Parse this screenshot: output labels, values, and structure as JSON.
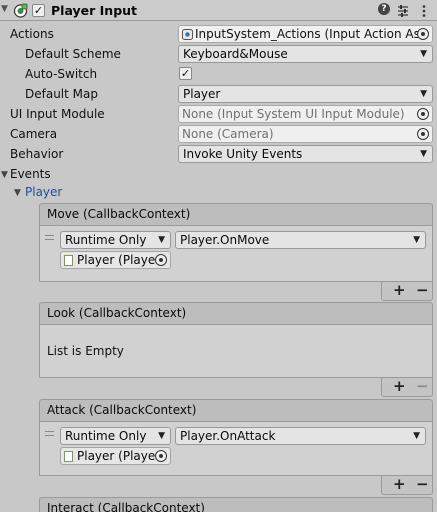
{
  "header": {
    "title": "Player Input",
    "help": "?",
    "enabled": "✓"
  },
  "props": {
    "actions": {
      "label": "Actions",
      "value": "InputSystem_Actions (Input Action Ass"
    },
    "default_scheme": {
      "label": "Default Scheme",
      "value": "Keyboard&Mouse"
    },
    "auto_switch": {
      "label": "Auto-Switch",
      "checked": "✓"
    },
    "default_map": {
      "label": "Default Map",
      "value": "Player"
    },
    "ui_input_module": {
      "label": "UI Input Module",
      "value": "None (Input System UI Input Module)"
    },
    "camera": {
      "label": "Camera",
      "value": "None (Camera)"
    },
    "behavior": {
      "label": "Behavior",
      "value": "Invoke Unity Events"
    }
  },
  "events": {
    "label": "Events",
    "map_label": "Player",
    "list": [
      {
        "title": "Move (CallbackContext)",
        "runtime": "Runtime Only",
        "function": "Player.OnMove",
        "target": "Player (Playe"
      },
      {
        "title": "Look (CallbackContext)",
        "empty": "List is Empty"
      },
      {
        "title": "Attack (CallbackContext)",
        "runtime": "Runtime Only",
        "function": "Player.OnAttack",
        "target": "Player (Playe"
      },
      {
        "title": "Interact (CallbackContext)"
      }
    ]
  },
  "icons": {
    "add": "+",
    "remove": "−",
    "dropdown": "▼",
    "foldout_open": "▼"
  }
}
